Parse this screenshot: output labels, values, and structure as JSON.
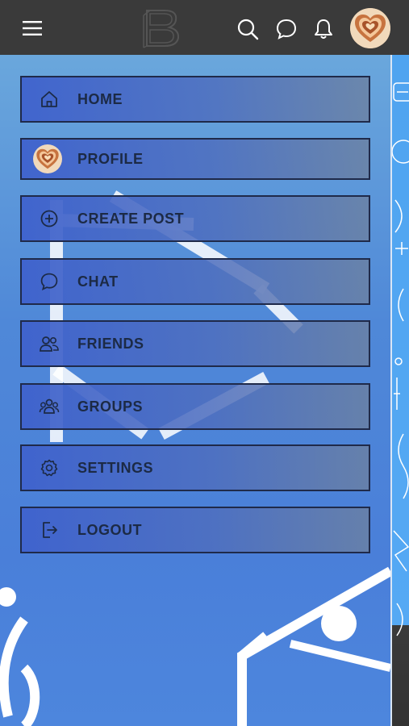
{
  "header": {
    "menu_icon": "hamburger-icon",
    "logo_icon": "b-logo-icon",
    "search_icon": "search-icon",
    "chat_icon": "chat-bubble-icon",
    "notifications_icon": "bell-icon",
    "avatar": "heart-avatar"
  },
  "menu": {
    "items": [
      {
        "label": "HOME",
        "icon": "home-icon"
      },
      {
        "label": "PROFILE",
        "icon": "heart-avatar"
      },
      {
        "label": "CREATE POST",
        "icon": "plus-circle-icon"
      },
      {
        "label": "CHAT",
        "icon": "chat-bubble-icon"
      },
      {
        "label": "FRIENDS",
        "icon": "friends-icon"
      },
      {
        "label": "GROUPS",
        "icon": "groups-icon"
      },
      {
        "label": "SETTINGS",
        "icon": "gear-icon"
      },
      {
        "label": "LOGOUT",
        "icon": "logout-icon"
      }
    ]
  },
  "colors": {
    "topbar": "#3a3a3a",
    "background": "#4a80d8",
    "menu_text": "#1c2a45",
    "menu_border": "#1f2a4a"
  }
}
